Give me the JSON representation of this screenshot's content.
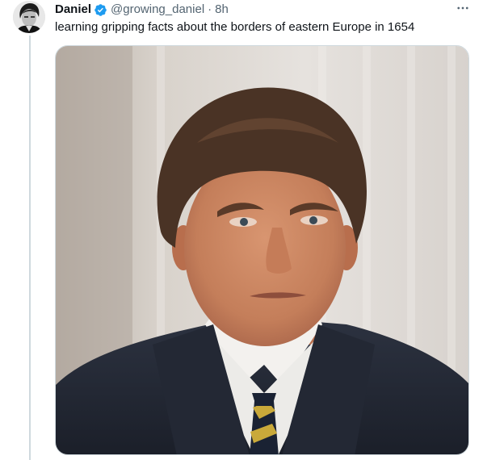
{
  "tweet": {
    "author_name": "Daniel",
    "verified": true,
    "handle": "@growing_daniel",
    "separator": "·",
    "timestamp": "8h",
    "text": "learning gripping facts about the borders of eastern Europe in 1654",
    "more_icon": "ellipsis-horizontal-icon",
    "media": {
      "type": "photo",
      "description_icon": "photo-of-man-in-suit"
    }
  },
  "colors": {
    "text_primary": "#0f1419",
    "text_secondary": "#536471",
    "verified_blue": "#1d9bf0",
    "thread_line": "#cfd9de"
  }
}
